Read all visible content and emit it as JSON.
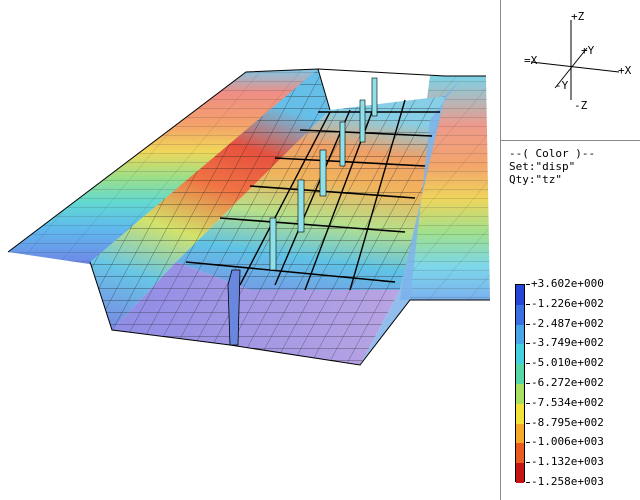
{
  "viewer": {
    "triad": {
      "plus_z": "+Z",
      "minus_z": "-Z",
      "plus_y": "+Y",
      "minus_y": "-Y",
      "plus_x": "+X",
      "minus_x": "=X"
    },
    "result_info": {
      "line1": "--( Color )--",
      "line2": "Set:\"disp\"",
      "line3": "Qty:\"tz\""
    },
    "legend": {
      "levels": [
        {
          "label": "+3.602e+000",
          "color": "#1e2fb0"
        },
        {
          "label": "-1.226e+002",
          "color": "#2646d8"
        },
        {
          "label": "-2.487e+002",
          "color": "#3a6fe4"
        },
        {
          "label": "-3.749e+002",
          "color": "#49a4ea"
        },
        {
          "label": "-5.010e+002",
          "color": "#44d0de"
        },
        {
          "label": "-6.272e+002",
          "color": "#55d7a7"
        },
        {
          "label": "-7.534e+002",
          "color": "#a7e061"
        },
        {
          "label": "-8.795e+002",
          "color": "#f3e238"
        },
        {
          "label": "-1.006e+003",
          "color": "#f5a92b"
        },
        {
          "label": "-1.132e+003",
          "color": "#ea5b20"
        },
        {
          "label": "-1.258e+003",
          "color": "#c21514"
        }
      ]
    }
  }
}
